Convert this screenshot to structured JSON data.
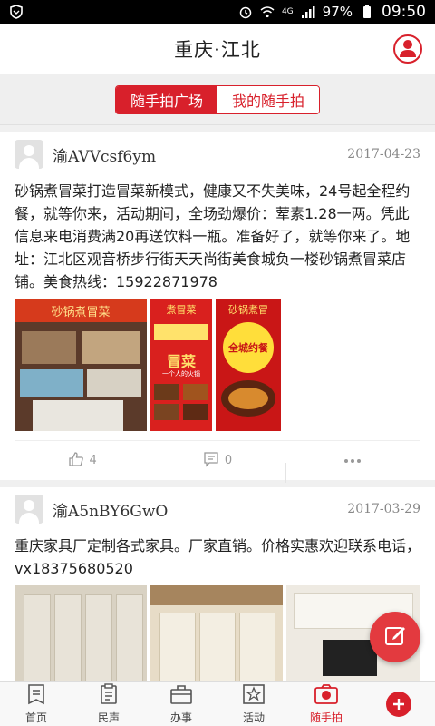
{
  "status_bar": {
    "battery": "97%",
    "time": "09:50",
    "network": "4G"
  },
  "header": {
    "title": "重庆·江北"
  },
  "tabs": [
    {
      "label": "随手拍广场",
      "active": true
    },
    {
      "label": "我的随手拍",
      "active": false
    }
  ],
  "posts": [
    {
      "username": "渝AVVcsf6ym",
      "date": "2017-04-23",
      "text": "砂锅煮冒菜打造冒菜新模式，健康又不失美味，24号起全程约餐，就等你来，活动期间，全场劲爆价：荤素1.28一两。凭此信息来电消费满20再送饮料一瓶。准备好了，就等你来了。地址：江北区观音桥步行街天天尚街美食城负一楼砂锅煮冒菜店铺。美食热线：15922871978",
      "images": [
        {
          "sign_top": "砂锅煮冒菜"
        },
        {
          "sign_top": "煮冒菜",
          "title": "冒菜",
          "sub": "一个人的火锅"
        },
        {
          "sign_top": "砂锅煮冒",
          "badge": "全城约餐"
        }
      ],
      "likes": "4",
      "comments": "0"
    },
    {
      "username": "渝A5nBY6GwO",
      "date": "2017-03-29",
      "text": "重庆家具厂定制各式家具。厂家直销。价格实惠欢迎联系电话，vx18375680520"
    }
  ],
  "bottom_nav": [
    {
      "label": "首页",
      "icon": "home-doc-icon",
      "active": false
    },
    {
      "label": "民声",
      "icon": "clipboard-icon",
      "active": false
    },
    {
      "label": "办事",
      "icon": "briefcase-icon",
      "active": false
    },
    {
      "label": "活动",
      "icon": "star-icon",
      "active": false
    },
    {
      "label": "随手拍",
      "icon": "camera-icon",
      "active": true
    }
  ],
  "colors": {
    "accent": "#d8202b",
    "fab": "#e33a3f"
  }
}
